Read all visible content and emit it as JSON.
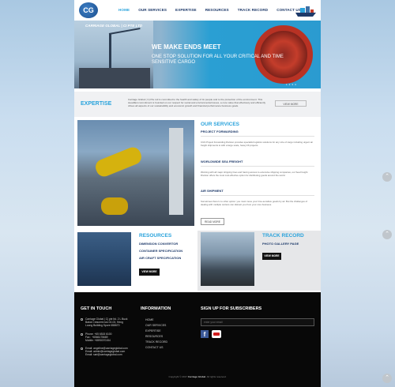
{
  "header": {
    "logo_text": "CG",
    "nav": [
      "HOME",
      "OUR SERVICES",
      "EXPERTISE",
      "RESOURCES",
      "TRACK RECORD",
      "CONTACT US"
    ]
  },
  "hero": {
    "brand": "CARRIAGE GLOBAL | CI PTE LTD",
    "title": "WE MAKE ENDS MEET",
    "subtitle": "ONE STOP SOLUTION FOR ALL YOUR CRITICAL AND TIME SENSITIVE CARGO",
    "dots": [
      "1",
      "2",
      "3",
      "4"
    ]
  },
  "expertise": {
    "title": "EXPERTISE",
    "text": "Carriage Global ( C) Pte Ltd is committed to the health and safety of its people and to the protection of the environment. This steadfast commitment is founded on our respect for social and environmental issues, a core value that effectively and efficiently drives all aspects of our sustainability and economic growth and financial performance business goals.",
    "button": "VIEW MORE"
  },
  "services": {
    "title": "OUR SERVICES",
    "items": [
      {
        "heading": "PROJECT FORWARDING",
        "text": "CGS Project Forwarding Division provides specialist logistics solutions for any size of cargo including urgent air freight shipments to with a large scale, heavy lift projects."
      },
      {
        "heading": "WORLDWIDE SEA FREIGHT",
        "text": "Working with all major shipping lines and having access to extensive shipping companies, our Sea Freight Division offers the most cost-effective option for distributing goods around the world."
      },
      {
        "heading": "AIR SHIPMENT",
        "text": "Sometimes there's no other option: you must move your time-sensitive goods by air. But the challenges of dealing with multiple carriers can distract you from your core business."
      }
    ],
    "button": "READ MORE"
  },
  "resources": {
    "title": "RESOURCES",
    "links": [
      "DIMENSION CONVERTOR",
      "CONTAINER SPECIFICATION",
      "AIR CRAFT SPECIFICATION"
    ],
    "button": "VIEW MORE"
  },
  "track_record": {
    "title": "TRACK RECORD",
    "link": "PHOTO GALLERY PAGE",
    "button": "VIEW MORE"
  },
  "footer": {
    "get_in_touch": {
      "title": "GET IN TOUCH",
      "address": [
        "Carriage Global | C| pte ltd. 2 L Buck",
        "Batok Crescent nos 02-03, Heng",
        "Loong Building Spore 658670"
      ],
      "phone": [
        "Phone: +65 6515 6100",
        "Fax : +6566175669",
        "Mobile: +6590070154"
      ],
      "email": [
        "Email: angeline@carriageglobal.com",
        "Email: admin@carriageglobal.com",
        "Email: sari@carriageglobal.com"
      ]
    },
    "information": {
      "title": "INFORMATION",
      "links": [
        "HOME",
        "OUR SERVICES",
        "EXPERTISE",
        "RESOURCES",
        "TRACK RECORD",
        "CONTACT US"
      ]
    },
    "subscribe": {
      "title": "SIGN UP FOR SUBSCRIBERS",
      "placeholder": "enter your email",
      "fb": "f"
    },
    "copyright_pre": "Copyright © 2017",
    "copyright_brand": "Carriage Global",
    "copyright_post": ". All rights reserved.",
    "colors": {
      "accent": "#2aa3dc",
      "navy": "#1e3a6a",
      "footer": "#080808"
    },
    "icons": [
      "facebook-icon",
      "youtube-icon",
      "location-icon",
      "phone-icon",
      "email-icon",
      "scroll-up-icon"
    ]
  }
}
